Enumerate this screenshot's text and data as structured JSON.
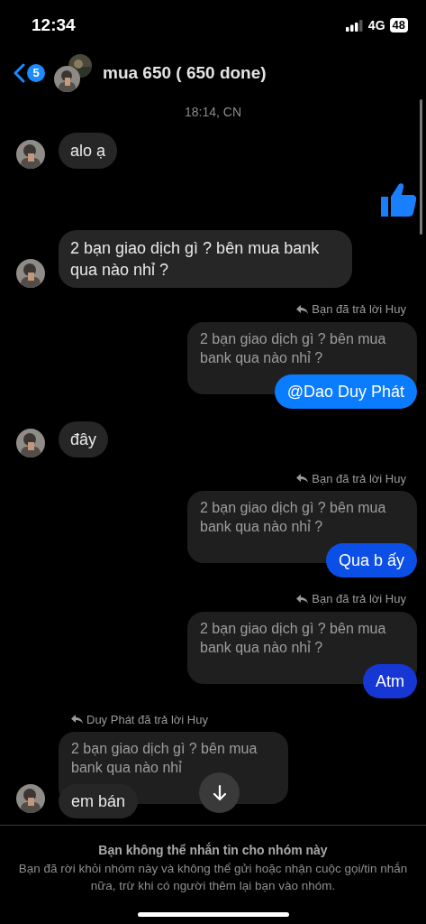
{
  "status_bar": {
    "time": "12:34",
    "network": "4G",
    "battery": "48"
  },
  "header": {
    "unread_count": "5",
    "title": "mua 650 ( 650 done)"
  },
  "messages": [
    {
      "kind": "timestamp",
      "text": "18:14, CN"
    },
    {
      "kind": "incoming",
      "text": "alo ạ"
    },
    {
      "kind": "like"
    },
    {
      "kind": "incoming",
      "text": "2 bạn giao dịch gì ? bên mua bank qua nào nhỉ ?"
    },
    {
      "kind": "reply_outgoing",
      "reply_label": "Bạn đã trả lời Huy",
      "quote": "2 bạn giao dịch gì ? bên mua bank qua nào nhỉ ?",
      "text": "@Dao Duy Phát",
      "color": "#0a7cff"
    },
    {
      "kind": "incoming",
      "text": "đây"
    },
    {
      "kind": "reply_outgoing",
      "reply_label": "Bạn đã trả lời Huy",
      "quote": "2 bạn giao dịch gì ? bên mua bank qua nào nhỉ ?",
      "text": "Qua b ấy",
      "color": "#0b4fe6"
    },
    {
      "kind": "reply_outgoing",
      "reply_label": "Bạn đã trả lời Huy",
      "quote": "2 bạn giao dịch gì ? bên mua bank qua nào nhỉ ?",
      "text": "Atm",
      "color": "#1737d4"
    },
    {
      "kind": "reply_incoming",
      "reply_label": "Duy Phát đã trả lời Huy",
      "quote": "2 bạn giao dịch gì ? bên mua bank qua nào nhỉ",
      "text": "em bán"
    }
  ],
  "footer": {
    "title": "Bạn không thể nhắn tin cho nhóm này",
    "body": "Bạn đã rời khỏi nhóm này và không thể gửi hoặc nhận cuộc gọi/tin nhắn nữa, trừ khi có người thêm lại bạn vào nhóm."
  }
}
